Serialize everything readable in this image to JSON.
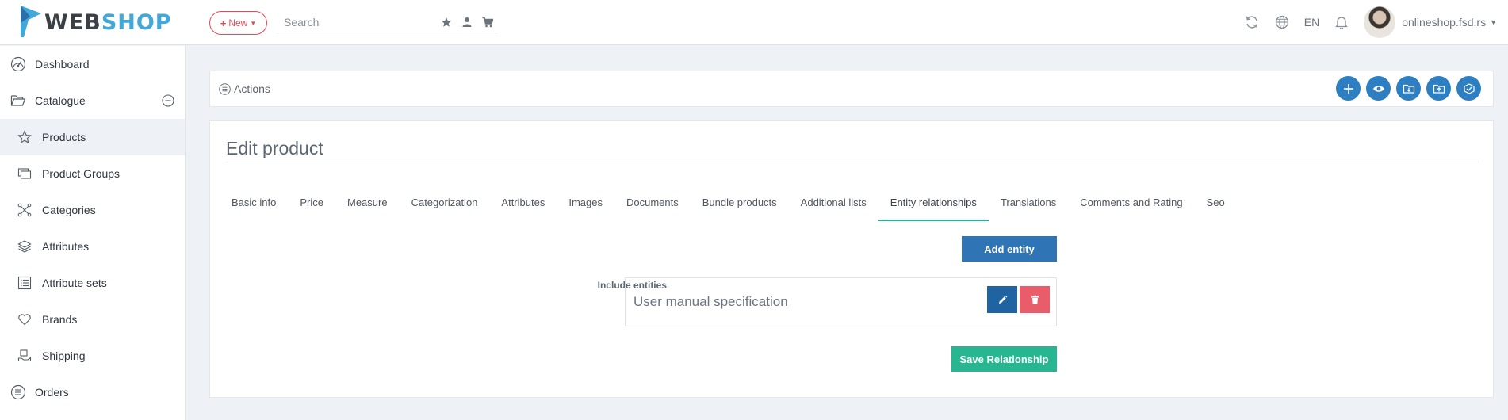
{
  "header": {
    "logo_web": "WEB",
    "logo_shop": "SHOP",
    "new_label": "New",
    "search_placeholder": "Search",
    "language": "EN",
    "store_name": "onlineshop.fsd.rs"
  },
  "sidebar": {
    "items": [
      {
        "label": "Dashboard",
        "icon": "dashboard-icon"
      },
      {
        "label": "Catalogue",
        "icon": "folder-icon"
      },
      {
        "label": "Products",
        "icon": "star-icon"
      },
      {
        "label": "Product Groups",
        "icon": "product-groups-icon"
      },
      {
        "label": "Categories",
        "icon": "categories-icon"
      },
      {
        "label": "Attributes",
        "icon": "layers-icon"
      },
      {
        "label": "Attribute sets",
        "icon": "list-icon"
      },
      {
        "label": "Brands",
        "icon": "heart-icon"
      },
      {
        "label": "Shipping",
        "icon": "shipping-icon"
      },
      {
        "label": "Orders",
        "icon": "orders-icon"
      }
    ]
  },
  "actions": {
    "label": "Actions"
  },
  "main": {
    "title": "Edit product",
    "tabs": [
      {
        "label": "Basic info"
      },
      {
        "label": "Price"
      },
      {
        "label": "Measure"
      },
      {
        "label": "Categorization"
      },
      {
        "label": "Attributes"
      },
      {
        "label": "Images"
      },
      {
        "label": "Documents"
      },
      {
        "label": "Bundle products"
      },
      {
        "label": "Additional lists"
      },
      {
        "label": "Entity relationships"
      },
      {
        "label": "Translations"
      },
      {
        "label": "Comments and Rating"
      },
      {
        "label": "Seo"
      }
    ],
    "active_tab": "Entity relationships",
    "add_entity_label": "Add entity",
    "include_label": "Include entities",
    "entity_name": "User manual specification",
    "save_label": "Save Relationship"
  },
  "colors": {
    "primary": "#2f75b6",
    "accent_green": "#27b690",
    "danger": "#e85d69",
    "brand_blue": "#42a7d9"
  }
}
